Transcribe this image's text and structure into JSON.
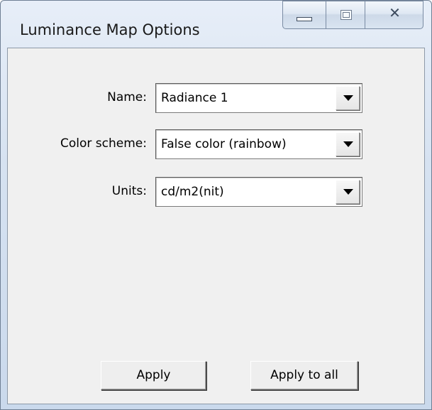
{
  "window": {
    "title": "Luminance Map Options",
    "controls": {
      "minimize_icon": "minimize-icon",
      "maximize_icon": "maximize-icon",
      "close_icon": "close-icon",
      "close_glyph": "✕"
    }
  },
  "form": {
    "name": {
      "label": "Name:",
      "value": "Radiance 1"
    },
    "color_scheme": {
      "label": "Color scheme:",
      "value": "False color (rainbow)"
    },
    "units": {
      "label": "Units:",
      "value": "cd/m2(nit)"
    }
  },
  "buttons": {
    "apply_label": "Apply",
    "apply_all_label": "Apply to all"
  },
  "colors": {
    "dialog_background": "#f0f0f0",
    "title_bar": "#d6e2f1"
  }
}
